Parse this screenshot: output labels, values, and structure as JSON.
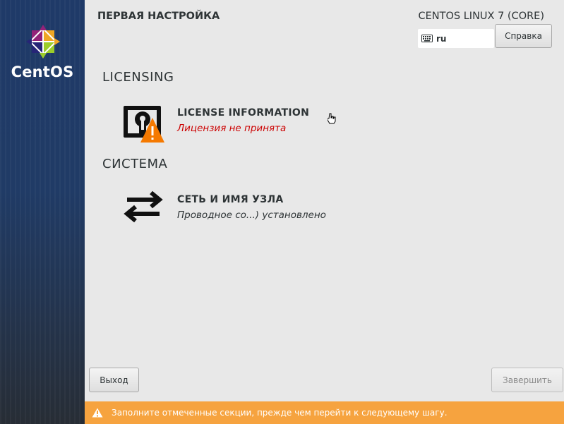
{
  "brand": {
    "name": "CentOS",
    "logo": "centos-logo"
  },
  "header": {
    "title": "ПЕРВАЯ НАСТРОЙКА",
    "product": "CENTOS LINUX 7 (CORE)",
    "keyboard_layout": "ru",
    "help_label": "Справка"
  },
  "sections": [
    {
      "title": "LICENSING",
      "spokes": [
        {
          "title": "LICENSE INFORMATION",
          "status": "Лицензия не принята",
          "status_color": "#cc0000",
          "icon": "license-warning-icon"
        }
      ]
    },
    {
      "title": "СИСТЕМА",
      "spokes": [
        {
          "title": "СЕТЬ И ИМЯ УЗЛА",
          "status": "Проводное со...) установлено",
          "icon": "network-arrows-icon"
        }
      ]
    }
  ],
  "footer": {
    "exit_label": "Выход",
    "finish_label": "Завершить",
    "warning": "Заполните отмеченные секции, прежде чем перейти к следующему шагу.",
    "warning_color": "#f6a33f"
  }
}
